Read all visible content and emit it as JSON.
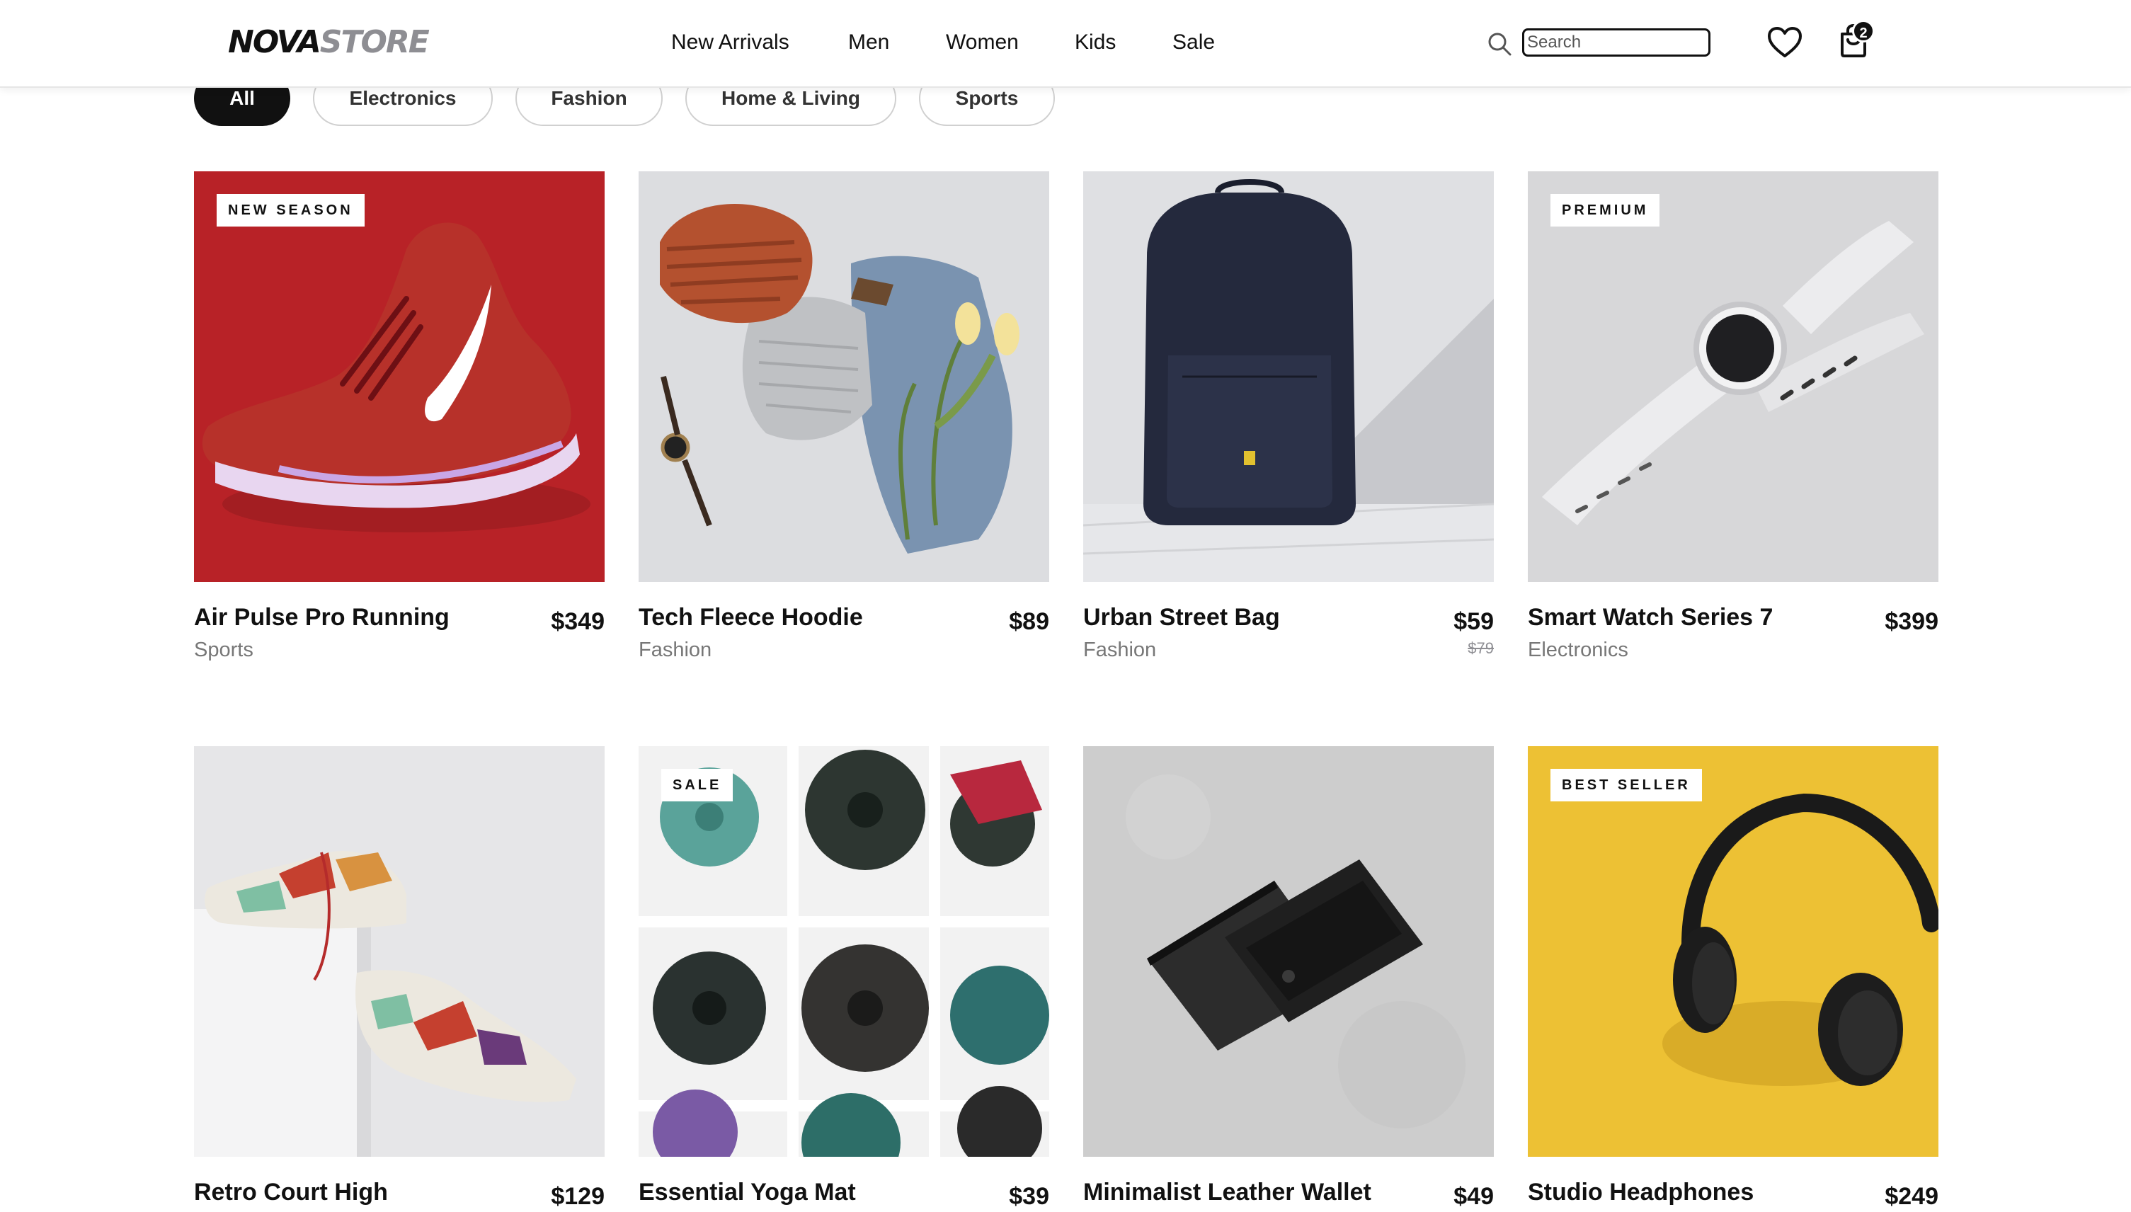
{
  "brand": {
    "part1": "NOVA",
    "part2": "STORE"
  },
  "nav": [
    "New Arrivals",
    "Men",
    "Women",
    "Kids",
    "Sale"
  ],
  "search": {
    "placeholder": "Search"
  },
  "cart": {
    "count": "2"
  },
  "categories": [
    "All",
    "Electronics",
    "Fashion",
    "Home & Living",
    "Sports"
  ],
  "active_category": "All",
  "colors": {
    "accent": "#111111",
    "muted_text": "#777777",
    "badge_bg": "#ffffff"
  },
  "products": [
    {
      "name": "Air Pulse Pro Running",
      "price": "$349",
      "category": "Sports",
      "badge": "NEW SEASON"
    },
    {
      "name": "Tech Fleece Hoodie",
      "price": "$89",
      "category": "Fashion"
    },
    {
      "name": "Urban Street Bag",
      "price": "$59",
      "old_price": "$79",
      "category": "Fashion"
    },
    {
      "name": "Smart Watch Series 7",
      "price": "$399",
      "category": "Electronics",
      "badge": "PREMIUM"
    },
    {
      "name": "Retro Court High",
      "price": "$129",
      "category": ""
    },
    {
      "name": "Essential Yoga Mat",
      "price": "$39",
      "category": "",
      "badge": "SALE"
    },
    {
      "name": "Minimalist Leather Wallet",
      "price": "$49",
      "category": ""
    },
    {
      "name": "Studio Headphones",
      "price": "$249",
      "category": "",
      "badge": "BEST SELLER"
    }
  ],
  "icons": [
    "search-icon",
    "heart-icon",
    "shopping-bag-icon"
  ]
}
